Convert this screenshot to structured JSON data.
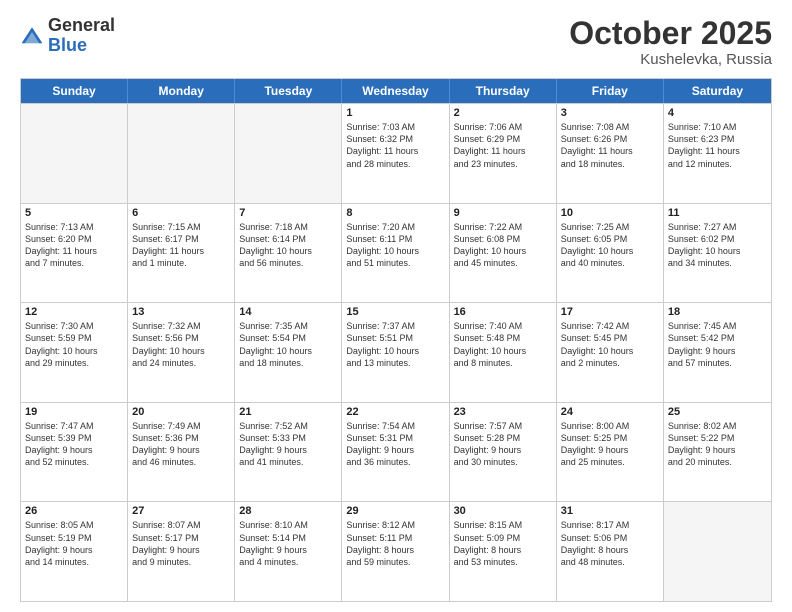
{
  "header": {
    "logo": {
      "general": "General",
      "blue": "Blue"
    },
    "title": "October 2025",
    "subtitle": "Kushelevka, Russia"
  },
  "weekdays": [
    "Sunday",
    "Monday",
    "Tuesday",
    "Wednesday",
    "Thursday",
    "Friday",
    "Saturday"
  ],
  "weeks": [
    [
      {
        "day": "",
        "info": "",
        "shade": true
      },
      {
        "day": "",
        "info": "",
        "shade": true
      },
      {
        "day": "",
        "info": "",
        "shade": true
      },
      {
        "day": "1",
        "info": "Sunrise: 7:03 AM\nSunset: 6:32 PM\nDaylight: 11 hours\nand 28 minutes.",
        "shade": false
      },
      {
        "day": "2",
        "info": "Sunrise: 7:06 AM\nSunset: 6:29 PM\nDaylight: 11 hours\nand 23 minutes.",
        "shade": false
      },
      {
        "day": "3",
        "info": "Sunrise: 7:08 AM\nSunset: 6:26 PM\nDaylight: 11 hours\nand 18 minutes.",
        "shade": false
      },
      {
        "day": "4",
        "info": "Sunrise: 7:10 AM\nSunset: 6:23 PM\nDaylight: 11 hours\nand 12 minutes.",
        "shade": false
      }
    ],
    [
      {
        "day": "5",
        "info": "Sunrise: 7:13 AM\nSunset: 6:20 PM\nDaylight: 11 hours\nand 7 minutes.",
        "shade": false
      },
      {
        "day": "6",
        "info": "Sunrise: 7:15 AM\nSunset: 6:17 PM\nDaylight: 11 hours\nand 1 minute.",
        "shade": false
      },
      {
        "day": "7",
        "info": "Sunrise: 7:18 AM\nSunset: 6:14 PM\nDaylight: 10 hours\nand 56 minutes.",
        "shade": false
      },
      {
        "day": "8",
        "info": "Sunrise: 7:20 AM\nSunset: 6:11 PM\nDaylight: 10 hours\nand 51 minutes.",
        "shade": false
      },
      {
        "day": "9",
        "info": "Sunrise: 7:22 AM\nSunset: 6:08 PM\nDaylight: 10 hours\nand 45 minutes.",
        "shade": false
      },
      {
        "day": "10",
        "info": "Sunrise: 7:25 AM\nSunset: 6:05 PM\nDaylight: 10 hours\nand 40 minutes.",
        "shade": false
      },
      {
        "day": "11",
        "info": "Sunrise: 7:27 AM\nSunset: 6:02 PM\nDaylight: 10 hours\nand 34 minutes.",
        "shade": false
      }
    ],
    [
      {
        "day": "12",
        "info": "Sunrise: 7:30 AM\nSunset: 5:59 PM\nDaylight: 10 hours\nand 29 minutes.",
        "shade": false
      },
      {
        "day": "13",
        "info": "Sunrise: 7:32 AM\nSunset: 5:56 PM\nDaylight: 10 hours\nand 24 minutes.",
        "shade": false
      },
      {
        "day": "14",
        "info": "Sunrise: 7:35 AM\nSunset: 5:54 PM\nDaylight: 10 hours\nand 18 minutes.",
        "shade": false
      },
      {
        "day": "15",
        "info": "Sunrise: 7:37 AM\nSunset: 5:51 PM\nDaylight: 10 hours\nand 13 minutes.",
        "shade": false
      },
      {
        "day": "16",
        "info": "Sunrise: 7:40 AM\nSunset: 5:48 PM\nDaylight: 10 hours\nand 8 minutes.",
        "shade": false
      },
      {
        "day": "17",
        "info": "Sunrise: 7:42 AM\nSunset: 5:45 PM\nDaylight: 10 hours\nand 2 minutes.",
        "shade": false
      },
      {
        "day": "18",
        "info": "Sunrise: 7:45 AM\nSunset: 5:42 PM\nDaylight: 9 hours\nand 57 minutes.",
        "shade": false
      }
    ],
    [
      {
        "day": "19",
        "info": "Sunrise: 7:47 AM\nSunset: 5:39 PM\nDaylight: 9 hours\nand 52 minutes.",
        "shade": false
      },
      {
        "day": "20",
        "info": "Sunrise: 7:49 AM\nSunset: 5:36 PM\nDaylight: 9 hours\nand 46 minutes.",
        "shade": false
      },
      {
        "day": "21",
        "info": "Sunrise: 7:52 AM\nSunset: 5:33 PM\nDaylight: 9 hours\nand 41 minutes.",
        "shade": false
      },
      {
        "day": "22",
        "info": "Sunrise: 7:54 AM\nSunset: 5:31 PM\nDaylight: 9 hours\nand 36 minutes.",
        "shade": false
      },
      {
        "day": "23",
        "info": "Sunrise: 7:57 AM\nSunset: 5:28 PM\nDaylight: 9 hours\nand 30 minutes.",
        "shade": false
      },
      {
        "day": "24",
        "info": "Sunrise: 8:00 AM\nSunset: 5:25 PM\nDaylight: 9 hours\nand 25 minutes.",
        "shade": false
      },
      {
        "day": "25",
        "info": "Sunrise: 8:02 AM\nSunset: 5:22 PM\nDaylight: 9 hours\nand 20 minutes.",
        "shade": false
      }
    ],
    [
      {
        "day": "26",
        "info": "Sunrise: 8:05 AM\nSunset: 5:19 PM\nDaylight: 9 hours\nand 14 minutes.",
        "shade": false
      },
      {
        "day": "27",
        "info": "Sunrise: 8:07 AM\nSunset: 5:17 PM\nDaylight: 9 hours\nand 9 minutes.",
        "shade": false
      },
      {
        "day": "28",
        "info": "Sunrise: 8:10 AM\nSunset: 5:14 PM\nDaylight: 9 hours\nand 4 minutes.",
        "shade": false
      },
      {
        "day": "29",
        "info": "Sunrise: 8:12 AM\nSunset: 5:11 PM\nDaylight: 8 hours\nand 59 minutes.",
        "shade": false
      },
      {
        "day": "30",
        "info": "Sunrise: 8:15 AM\nSunset: 5:09 PM\nDaylight: 8 hours\nand 53 minutes.",
        "shade": false
      },
      {
        "day": "31",
        "info": "Sunrise: 8:17 AM\nSunset: 5:06 PM\nDaylight: 8 hours\nand 48 minutes.",
        "shade": false
      },
      {
        "day": "",
        "info": "",
        "shade": true
      }
    ]
  ]
}
